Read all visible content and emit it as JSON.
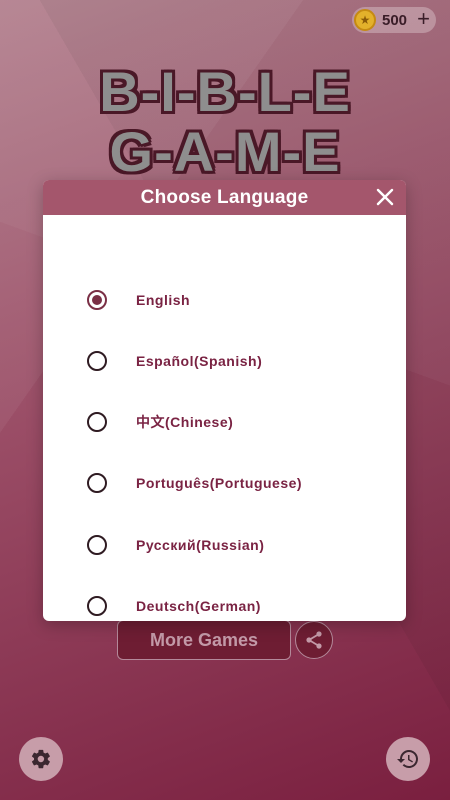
{
  "colors": {
    "accent": "#a4566c",
    "label": "#7a2343",
    "background_top": "#b07c8a",
    "background_bottom": "#7a1f3f"
  },
  "coins": {
    "count": "500",
    "icon": "star-coin-icon",
    "plus_icon": "plus-icon"
  },
  "logo": {
    "line1": "B-I-B-L-E",
    "line2": "G-A-M-E"
  },
  "dialog": {
    "title": "Choose Language",
    "close_icon": "close-icon",
    "options": [
      {
        "label": "English",
        "selected": true
      },
      {
        "label": "Español(Spanish)",
        "selected": false
      },
      {
        "label": "中文(Chinese)",
        "selected": false
      },
      {
        "label": "Português(Portuguese)",
        "selected": false
      },
      {
        "label": "Русский(Russian)",
        "selected": false
      },
      {
        "label": "Deutsch(German)",
        "selected": false
      }
    ]
  },
  "footer": {
    "more_games": "More Games",
    "share_icon": "share-icon",
    "settings_icon": "gear-icon",
    "history_icon": "history-icon"
  }
}
